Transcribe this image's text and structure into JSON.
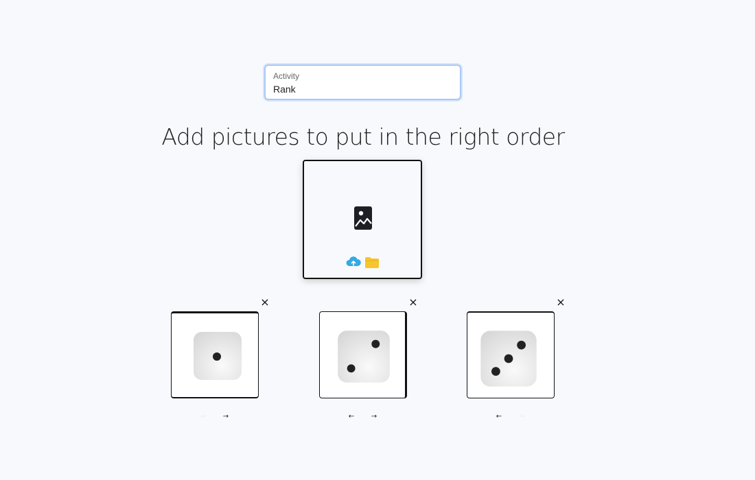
{
  "activity": {
    "label": "Activity",
    "value": "Rank"
  },
  "heading": "Add pictures to put in the right order",
  "upload": {
    "image_icon": "image-placeholder-icon",
    "cloud_icon": "cloud-upload-icon",
    "folder_icon": "folder-icon",
    "colors": {
      "cloud": "#36a9e1",
      "folder": "#f7c52c"
    }
  },
  "cards": [
    {
      "name": "die-face-one",
      "pips": 1,
      "close": "×",
      "prev": "←",
      "next": "→",
      "prev_enabled": false,
      "next_enabled": true
    },
    {
      "name": "die-face-two",
      "pips": 2,
      "close": "×",
      "prev": "←",
      "next": "→",
      "prev_enabled": true,
      "next_enabled": true
    },
    {
      "name": "die-face-three",
      "pips": 3,
      "close": "×",
      "prev": "←",
      "next": "→",
      "prev_enabled": true,
      "next_enabled": false
    }
  ]
}
